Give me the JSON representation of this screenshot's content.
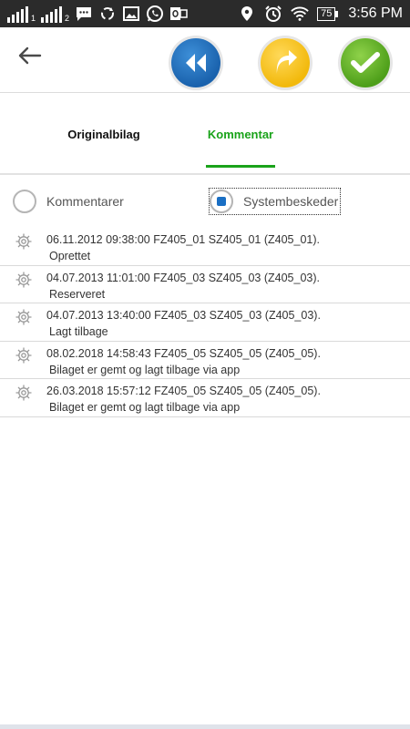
{
  "status_bar": {
    "sim1_label": "1",
    "sim2_label": "2",
    "battery": "75",
    "time": "3:56 PM",
    "icons": [
      "signal-sim1-icon",
      "signal-sim2-icon",
      "message-icon",
      "sync-icon",
      "gallery-icon",
      "whatsapp-icon",
      "outlook-icon",
      "location-icon",
      "alarm-icon",
      "wifi-icon",
      "battery-icon"
    ]
  },
  "toolbar": {
    "back_icon": "arrow-left-icon",
    "buttons": [
      {
        "name": "rewind",
        "icon": "double-chevron-left-icon",
        "color": "#1a62ad"
      },
      {
        "name": "forward",
        "icon": "curved-arrow-right-icon",
        "color": "#f2b90c"
      },
      {
        "name": "confirm",
        "icon": "checkmark-icon",
        "color": "#4e9f1a"
      }
    ]
  },
  "tabs": {
    "original": "Originalbilag",
    "comment": "Kommentar",
    "active": "Kommentar",
    "active_color": "#1aa31a"
  },
  "filter": {
    "option1": "Kommentarer",
    "option2": "Systembeskeder",
    "selected": "Systembeskeder"
  },
  "log": [
    {
      "line1": "06.11.2012 09:38:00 FZ405_01 SZ405_01 (Z405_01).",
      "line2": "Oprettet"
    },
    {
      "line1": "04.07.2013 11:01:00 FZ405_03 SZ405_03 (Z405_03).",
      "line2": "Reserveret"
    },
    {
      "line1": "04.07.2013 13:40:00 FZ405_03 SZ405_03 (Z405_03).",
      "line2": "Lagt tilbage"
    },
    {
      "line1": "08.02.2018 14:58:43 FZ405_05 SZ405_05 (Z405_05).",
      "line2": "Bilaget er gemt og lagt tilbage via app"
    },
    {
      "line1": "26.03.2018 15:57:12 FZ405_05 SZ405_05 (Z405_05).",
      "line2": "Bilaget er gemt og lagt tilbage via app"
    }
  ]
}
